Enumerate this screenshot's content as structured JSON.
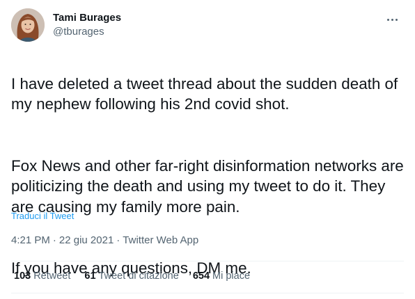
{
  "author": {
    "display_name": "Tami Burages",
    "handle": "@tburages"
  },
  "tweet": {
    "paragraphs": [
      "I have deleted a tweet thread about the sudden death of my nephew following his 2nd covid shot.",
      "Fox News and other far-right disinformation networks are politicizing the death and using my tweet to do it. They are causing my family more pain.",
      "If you have any questions, DM me."
    ],
    "translate_label": "Traduci il Tweet",
    "time": "4:21 PM",
    "date": "22 giu 2021",
    "source": "Twitter Web App",
    "separator": "·"
  },
  "stats": {
    "retweets_count": "103",
    "retweets_label": "Retweet",
    "quotes_count": "61",
    "quotes_label": "Tweet di citazione",
    "likes_count": "654",
    "likes_label": "Mi piace"
  },
  "colors": {
    "link": "#1d9bf0",
    "secondary_text": "#536471",
    "primary_text": "#0f1419"
  },
  "icons": {
    "more": "more-horizontal-icon"
  }
}
